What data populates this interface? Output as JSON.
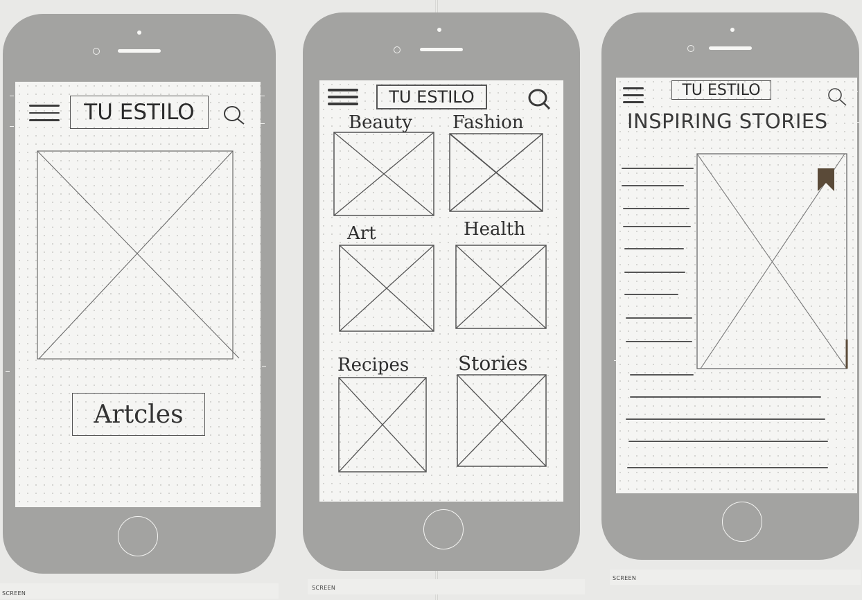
{
  "logo_text": "TU ESTILO",
  "screen_label": "SCREEN",
  "screen1": {
    "button_label": "Artcles"
  },
  "screen2": {
    "categories": [
      "Beauty",
      "Fashion",
      "Art",
      "Health",
      "Recipes",
      "Stories"
    ]
  },
  "screen3": {
    "title": "INSPIRING STORIES"
  },
  "icons": {
    "menu": "hamburger-icon",
    "search": "search-icon",
    "placeholder": "image-placeholder-x",
    "bookmark": "bookmark-icon"
  },
  "colors": {
    "phone_body": "#a3a3a1",
    "screen_paper": "#f5f5f3",
    "pencil": "#3a3a3a",
    "bookmark": "#5a4a38"
  }
}
